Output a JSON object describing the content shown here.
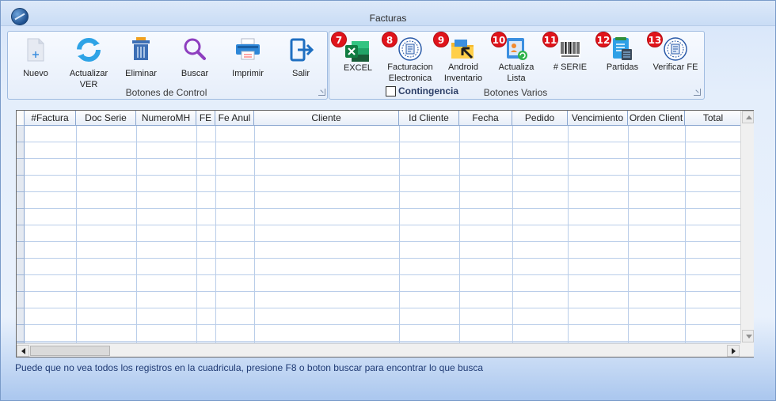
{
  "window": {
    "title": "Facturas"
  },
  "control_group": {
    "label": "Botones de Control",
    "buttons": [
      {
        "id": "nuevo",
        "label": "Nuevo",
        "icon": "new-document-icon"
      },
      {
        "id": "actualizar",
        "label": "Actualizar VER",
        "line1": "Actualizar",
        "line2": "VER",
        "icon": "refresh-icon"
      },
      {
        "id": "eliminar",
        "label": "Eliminar",
        "icon": "trash-icon"
      },
      {
        "id": "buscar",
        "label": "Buscar",
        "icon": "search-icon"
      },
      {
        "id": "imprimir",
        "label": "Imprimir",
        "icon": "printer-icon"
      },
      {
        "id": "salir",
        "label": "Salir",
        "icon": "exit-door-icon"
      }
    ]
  },
  "varios_group": {
    "label": "Botones Varios",
    "buttons": [
      {
        "id": "excel",
        "badge": "7",
        "line1": "EXCEL",
        "line2": "",
        "icon": "excel-icon"
      },
      {
        "id": "facturacion",
        "badge": "8",
        "line1": "Facturacion",
        "line2": "Electronica",
        "icon": "electronic-invoice-seal-icon"
      },
      {
        "id": "android",
        "badge": "9",
        "line1": "Android",
        "line2": "Inventario",
        "icon": "folder-arrow-icon"
      },
      {
        "id": "actualiza",
        "badge": "10",
        "line1": "Actualiza",
        "line2": "Lista",
        "icon": "update-list-icon"
      },
      {
        "id": "serie",
        "badge": "11",
        "line1": "# SERIE",
        "line2": "",
        "icon": "barcode-icon"
      },
      {
        "id": "partidas",
        "badge": "12",
        "line1": "Partidas",
        "line2": "",
        "icon": "calculator-list-icon"
      },
      {
        "id": "verificar",
        "badge": "13",
        "line1": "Verificar FE",
        "line2": "",
        "icon": "electronic-invoice-seal-icon"
      }
    ],
    "contingencia": {
      "label": "Contingencia",
      "checked": false
    }
  },
  "grid": {
    "columns": [
      "#Factura",
      "Doc Serie",
      "NumeroMH",
      "FE",
      "Fe Anul",
      "Cliente",
      "Id Cliente",
      "Fecha",
      "Pedido",
      "Vencimiento",
      "Orden Client",
      "Total"
    ]
  },
  "hint": "Puede que no vea todos los registros en la cuadricula, presione F8 o boton buscar para encontrar lo que busca",
  "colors": {
    "badge": "#e0141b",
    "accent": "#9fbbe0",
    "hint_text": "#1f3a73"
  }
}
